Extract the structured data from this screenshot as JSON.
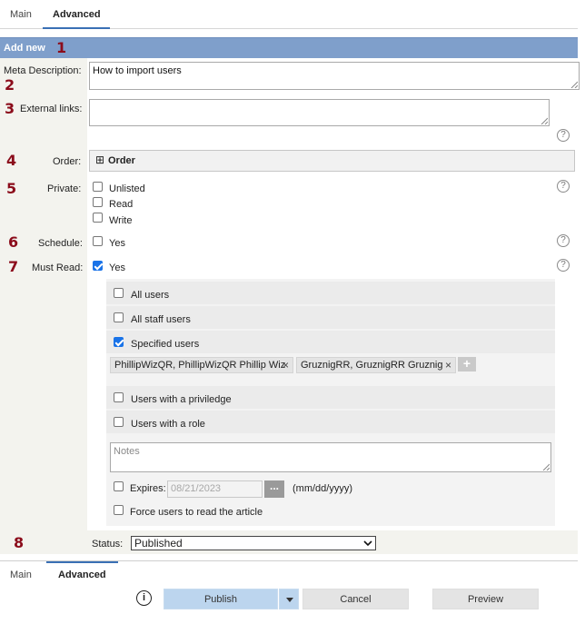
{
  "tabs_top": [
    {
      "label": "Main"
    },
    {
      "label": "Advanced"
    }
  ],
  "header": {
    "title": "Add new"
  },
  "markers": [
    "1",
    "2",
    "3",
    "4",
    "5",
    "6",
    "7",
    "8"
  ],
  "labels": {
    "meta_description": "Meta Description:",
    "external_links": "External links:",
    "order": "Order:",
    "private": "Private:",
    "schedule": "Schedule:",
    "must_read": "Must Read:",
    "status": "Status:"
  },
  "meta_description_value": "How to import users",
  "external_links_value": "",
  "order_section": {
    "icon": "⊞",
    "label": "Order"
  },
  "private_options": [
    {
      "label": "Unlisted",
      "checked": false
    },
    {
      "label": "Read",
      "checked": false
    },
    {
      "label": "Write",
      "checked": false
    }
  ],
  "schedule": {
    "label": "Yes",
    "checked": false
  },
  "must_read": {
    "label": "Yes",
    "checked": true
  },
  "must_read_options": {
    "all_users": "All users",
    "all_staff_users": "All staff users",
    "specified_users": "Specified users",
    "users_with_privilege": "Users with a priviledge",
    "users_with_role": "Users with a role"
  },
  "specified_users_chips": [
    {
      "label": "PhillipWizQR, PhillipWizQR Phillip Wiz"
    },
    {
      "label": "GruznigRR, GruznigRR Gruznig"
    }
  ],
  "chip_remove_glyph": "×",
  "chip_add_glyph": "+",
  "notes_placeholder": "Notes",
  "expires": {
    "label": "Expires:",
    "value": "08/21/2023",
    "picker_label": "...",
    "hint": "(mm/dd/yyyy)"
  },
  "force_read_label": "Force users to read the article",
  "status": {
    "value": "Published",
    "options": [
      "Published"
    ]
  },
  "tabs_bottom": [
    {
      "label": "Main"
    },
    {
      "label": "Advanced"
    }
  ],
  "buttons": {
    "publish": "Publish",
    "cancel": "Cancel",
    "preview": "Preview"
  },
  "help_glyph": "?",
  "info_glyph": "i",
  "colors": {
    "header_bg": "#7f9fcb",
    "marker": "#8b0c1b",
    "accent": "#3a70b5",
    "check": "#1a73e8",
    "publish_bg": "#bcd5ee"
  }
}
